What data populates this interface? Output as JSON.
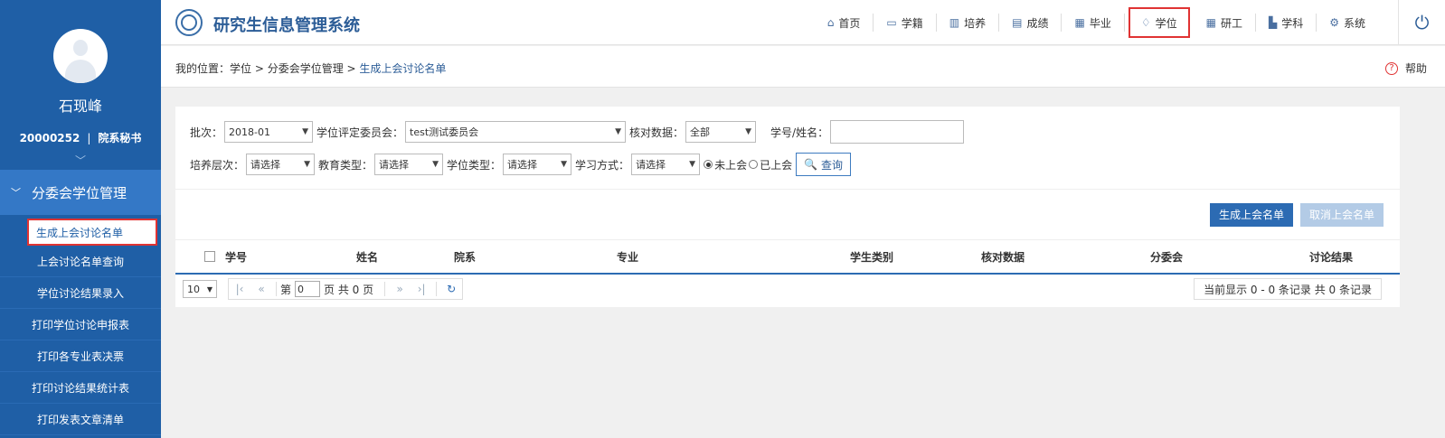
{
  "app": {
    "title": "研究生信息管理系统"
  },
  "user": {
    "name": "石现峰",
    "id": "20000252",
    "role": "院系秘书"
  },
  "sidebar": {
    "group": "分委会学位管理",
    "items": [
      {
        "label": "生成上会讨论名单"
      },
      {
        "label": "上会讨论名单查询"
      },
      {
        "label": "学位讨论结果录入"
      },
      {
        "label": "打印学位讨论申报表"
      },
      {
        "label": "打印各专业表决票"
      },
      {
        "label": "打印讨论结果统计表"
      },
      {
        "label": "打印发表文章清单"
      }
    ]
  },
  "nav": {
    "items": [
      {
        "label": "首页",
        "icon": "home-icon"
      },
      {
        "label": "学籍",
        "icon": "id-card-icon"
      },
      {
        "label": "培养",
        "icon": "chart-icon"
      },
      {
        "label": "成绩",
        "icon": "document-icon"
      },
      {
        "label": "毕业",
        "icon": "certificate-icon"
      },
      {
        "label": "学位",
        "icon": "graduation-cap-icon"
      },
      {
        "label": "研工",
        "icon": "grid-icon"
      },
      {
        "label": "学科",
        "icon": "building-icon"
      },
      {
        "label": "系统",
        "icon": "gear-icon"
      }
    ]
  },
  "breadcrumb": {
    "prefix": "我的位置：",
    "path": "学位 > 分委会学位管理 > ",
    "current": "生成上会讨论名单"
  },
  "help": {
    "label": "帮助"
  },
  "filters": {
    "batch_label": "批次：",
    "batch_value": "2018-01",
    "committee_label": "学位评定委员会：",
    "committee_value": "test测试委员会",
    "verify_label": "核对数据：",
    "verify_value": "全部",
    "student_label": "学号/姓名：",
    "level_label": "培养层次：",
    "level_value": "请选择",
    "edu_label": "教育类型：",
    "edu_value": "请选择",
    "degree_label": "学位类型：",
    "degree_value": "请选择",
    "study_label": "学习方式：",
    "study_value": "请选择",
    "radio_not": "未上会",
    "radio_done": "已上会",
    "query_label": "查询"
  },
  "actions": {
    "generate": "生成上会名单",
    "cancel": "取消上会名单"
  },
  "table": {
    "columns": [
      "学号",
      "姓名",
      "院系",
      "专业",
      "学生类别",
      "核对数据",
      "分委会",
      "讨论结果"
    ]
  },
  "pager": {
    "page_size": "10",
    "page_prefix": "第",
    "page_value": "0",
    "page_suffix": "页 共 0 页",
    "info": "当前显示 0 - 0 条记录 共 0 条记录"
  }
}
